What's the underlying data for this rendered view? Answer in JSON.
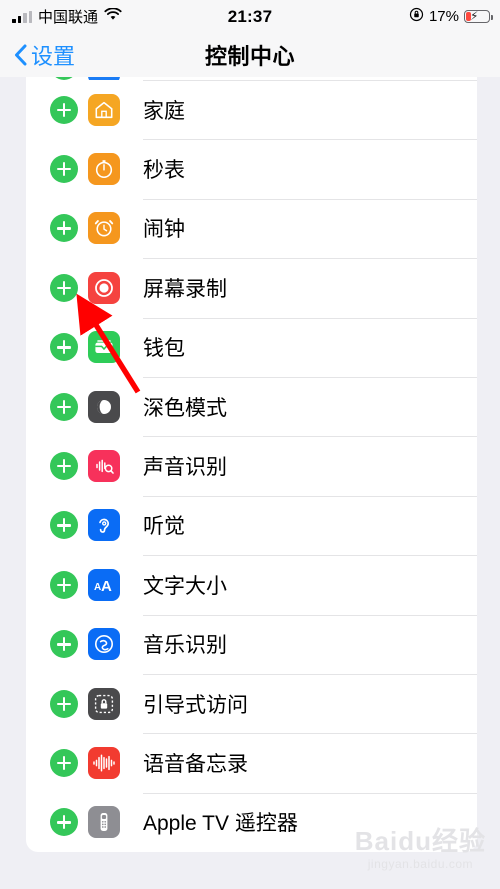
{
  "status_bar": {
    "carrier": "中国联通",
    "wifi_icon": "wifi-icon",
    "signal_icon": "cellular-signal-icon",
    "time": "21:37",
    "rotation_lock_icon": "rotation-lock-icon",
    "battery_percent": "17%",
    "battery_icon": "battery-charging-icon"
  },
  "nav_bar": {
    "back_icon": "chevron-left-icon",
    "back_label": "设置",
    "title": "控制中心"
  },
  "list": {
    "partial_top_row": {
      "add_icon": "plus-circle-icon",
      "app_icon": "blue-app-icon"
    },
    "rows": [
      {
        "label": "家庭",
        "icon": "home-icon",
        "add_icon": "plus-circle-icon"
      },
      {
        "label": "秒表",
        "icon": "stopwatch-icon",
        "add_icon": "plus-circle-icon"
      },
      {
        "label": "闹钟",
        "icon": "alarm-clock-icon",
        "add_icon": "plus-circle-icon"
      },
      {
        "label": "屏幕录制",
        "icon": "screen-record-icon",
        "add_icon": "plus-circle-icon"
      },
      {
        "label": "钱包",
        "icon": "wallet-icon",
        "add_icon": "plus-circle-icon"
      },
      {
        "label": "深色模式",
        "icon": "dark-mode-icon",
        "add_icon": "plus-circle-icon"
      },
      {
        "label": "声音识别",
        "icon": "sound-recognition-icon",
        "add_icon": "plus-circle-icon"
      },
      {
        "label": "听觉",
        "icon": "hearing-icon",
        "add_icon": "plus-circle-icon"
      },
      {
        "label": "文字大小",
        "icon": "text-size-icon",
        "add_icon": "plus-circle-icon"
      },
      {
        "label": "音乐识别",
        "icon": "music-recognition-icon",
        "add_icon": "plus-circle-icon"
      },
      {
        "label": "引导式访问",
        "icon": "guided-access-icon",
        "add_icon": "plus-circle-icon"
      },
      {
        "label": "语音备忘录",
        "icon": "voice-memos-icon",
        "add_icon": "plus-circle-icon"
      },
      {
        "label": "Apple TV 遥控器",
        "icon": "apple-tv-remote-icon",
        "add_icon": "plus-circle-icon"
      }
    ]
  },
  "annotation": {
    "arrow_icon": "red-arrow-annotation",
    "color": "#FF0000",
    "points_at": "屏幕录制"
  },
  "watermark": {
    "main": "Baidu经验",
    "sub": "jingyan.baidu.com"
  },
  "colors": {
    "add_button": "#34C759",
    "accent_blue": "#1E90FF",
    "background": "#EFEFF4",
    "card": "#FFFFFF",
    "separator": "#E4E4E6"
  }
}
